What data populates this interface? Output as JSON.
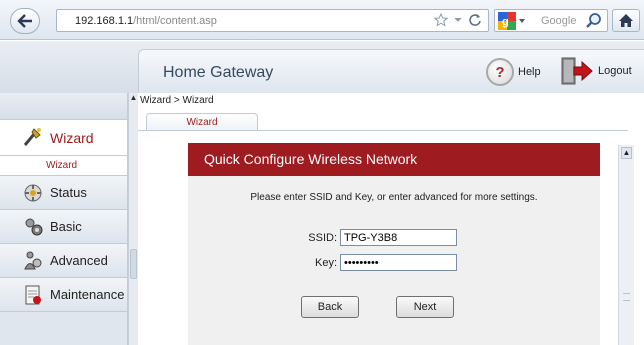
{
  "browser": {
    "url_host": "192.168.1.1",
    "url_path": "/html/content.asp",
    "search_placeholder": "Google"
  },
  "header": {
    "brand": "Home Gateway",
    "help_label": "Help",
    "logout_label": "Logout"
  },
  "sidebar": {
    "items": [
      {
        "label": "Wizard",
        "icon": "wizard-icon",
        "active": true
      },
      {
        "label": "Status",
        "icon": "status-icon"
      },
      {
        "label": "Basic",
        "icon": "basic-icon"
      },
      {
        "label": "Advanced",
        "icon": "advanced-icon"
      },
      {
        "label": "Maintenance",
        "icon": "maintenance-icon"
      }
    ],
    "sub_item": "Wizard"
  },
  "main": {
    "breadcrumb": "Wizard > Wizard",
    "tab": "Wizard",
    "panel_title": "Quick Configure Wireless Network",
    "instruction": "Please enter SSID and Key, or enter advanced for more settings.",
    "ssid_label": "SSID:",
    "ssid_value": "TPG-Y3B8",
    "key_label": "Key:",
    "key_value": "xxxxxxxxx",
    "back_label": "Back",
    "next_label": "Next"
  },
  "colors": {
    "accent_red": "#9e1b20",
    "brand_blue": "#36495f"
  }
}
